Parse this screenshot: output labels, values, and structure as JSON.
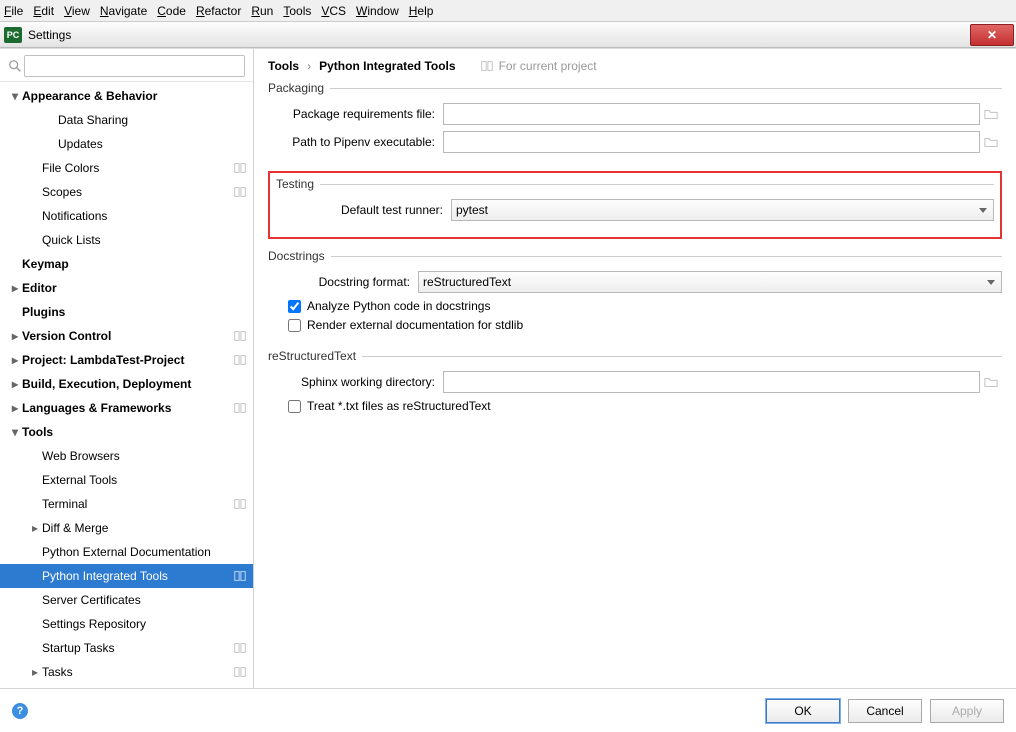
{
  "menubar": [
    "File",
    "Edit",
    "View",
    "Navigate",
    "Code",
    "Refactor",
    "Run",
    "Tools",
    "VCS",
    "Window",
    "Help"
  ],
  "window": {
    "title": "Settings"
  },
  "breadcrumb": {
    "a": "Tools",
    "b": "Python Integrated Tools",
    "note": "For current project"
  },
  "sidebar": {
    "items": [
      {
        "label": "Appearance & Behavior",
        "bold": true,
        "arrow": "down",
        "indent": 0
      },
      {
        "label": "Data Sharing",
        "indent": 2
      },
      {
        "label": "Updates",
        "indent": 2
      },
      {
        "label": "File Colors",
        "indent": 1,
        "proj": true
      },
      {
        "label": "Scopes",
        "indent": 1,
        "proj": true
      },
      {
        "label": "Notifications",
        "indent": 1
      },
      {
        "label": "Quick Lists",
        "indent": 1
      },
      {
        "label": "Keymap",
        "bold": true,
        "indent": 0,
        "noarrow": true
      },
      {
        "label": "Editor",
        "bold": true,
        "arrow": "right",
        "indent": 0
      },
      {
        "label": "Plugins",
        "bold": true,
        "indent": 0,
        "noarrow": true
      },
      {
        "label": "Version Control",
        "bold": true,
        "arrow": "right",
        "indent": 0,
        "proj": true
      },
      {
        "label": "Project: LambdaTest-Project",
        "bold": true,
        "arrow": "right",
        "indent": 0,
        "proj": true
      },
      {
        "label": "Build, Execution, Deployment",
        "bold": true,
        "arrow": "right",
        "indent": 0
      },
      {
        "label": "Languages & Frameworks",
        "bold": true,
        "arrow": "right",
        "indent": 0,
        "proj": true
      },
      {
        "label": "Tools",
        "bold": true,
        "arrow": "down",
        "indent": 0
      },
      {
        "label": "Web Browsers",
        "indent": 1
      },
      {
        "label": "External Tools",
        "indent": 1
      },
      {
        "label": "Terminal",
        "indent": 1,
        "proj": true
      },
      {
        "label": "Diff & Merge",
        "arrow": "right",
        "indent": 1
      },
      {
        "label": "Python External Documentation",
        "indent": 1
      },
      {
        "label": "Python Integrated Tools",
        "indent": 1,
        "proj": true,
        "selected": true
      },
      {
        "label": "Server Certificates",
        "indent": 1
      },
      {
        "label": "Settings Repository",
        "indent": 1
      },
      {
        "label": "Startup Tasks",
        "indent": 1,
        "proj": true
      },
      {
        "label": "Tasks",
        "arrow": "right",
        "indent": 1,
        "proj": true
      }
    ]
  },
  "sections": {
    "packaging": {
      "title": "Packaging",
      "req_label": "Package requirements file:",
      "req_value": "",
      "pipenv_label": "Path to Pipenv executable:",
      "pipenv_value": ""
    },
    "testing": {
      "title": "Testing",
      "runner_label": "Default test runner:",
      "runner_value": "pytest"
    },
    "docstrings": {
      "title": "Docstrings",
      "format_label": "Docstring format:",
      "format_value": "reStructuredText",
      "analyze": "Analyze Python code in docstrings",
      "analyze_checked": true,
      "render": "Render external documentation for stdlib",
      "render_checked": false
    },
    "rst": {
      "title": "reStructuredText",
      "sphinx_label": "Sphinx working directory:",
      "sphinx_value": "",
      "treat": "Treat *.txt files as reStructuredText",
      "treat_checked": false
    }
  },
  "footer": {
    "ok": "OK",
    "cancel": "Cancel",
    "apply": "Apply"
  }
}
